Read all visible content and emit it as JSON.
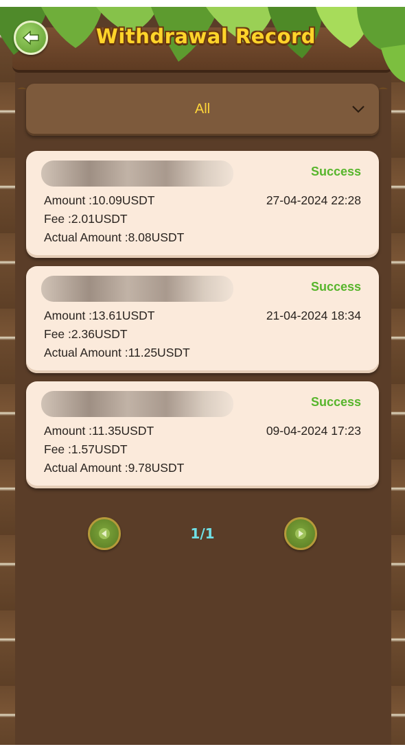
{
  "header": {
    "title": "Withdrawal Record",
    "back_icon": "arrow-left-icon"
  },
  "filter": {
    "selected": "All",
    "icon": "chevron-down-icon"
  },
  "records": [
    {
      "status": "Success",
      "amount": "Amount :10.09USDT",
      "fee": "Fee :2.01USDT",
      "actual": "Actual Amount :8.08USDT",
      "datetime": "27-04-2024 22:28"
    },
    {
      "status": "Success",
      "amount": "Amount :13.61USDT",
      "fee": "Fee :2.36USDT",
      "actual": "Actual Amount :11.25USDT",
      "datetime": "21-04-2024 18:34"
    },
    {
      "status": "Success",
      "amount": "Amount :11.35USDT",
      "fee": "Fee :1.57USDT",
      "actual": "Actual Amount :9.78USDT",
      "datetime": "09-04-2024 17:23"
    }
  ],
  "pagination": {
    "label": "1/1",
    "prev_icon": "triangle-left-icon",
    "next_icon": "triangle-right-icon"
  },
  "colors": {
    "background": "#5a3d28",
    "status_success": "#57b52c",
    "title": "#ffd42a",
    "filter_text": "#ffd63a",
    "pager_text": "#6fe0e6"
  }
}
